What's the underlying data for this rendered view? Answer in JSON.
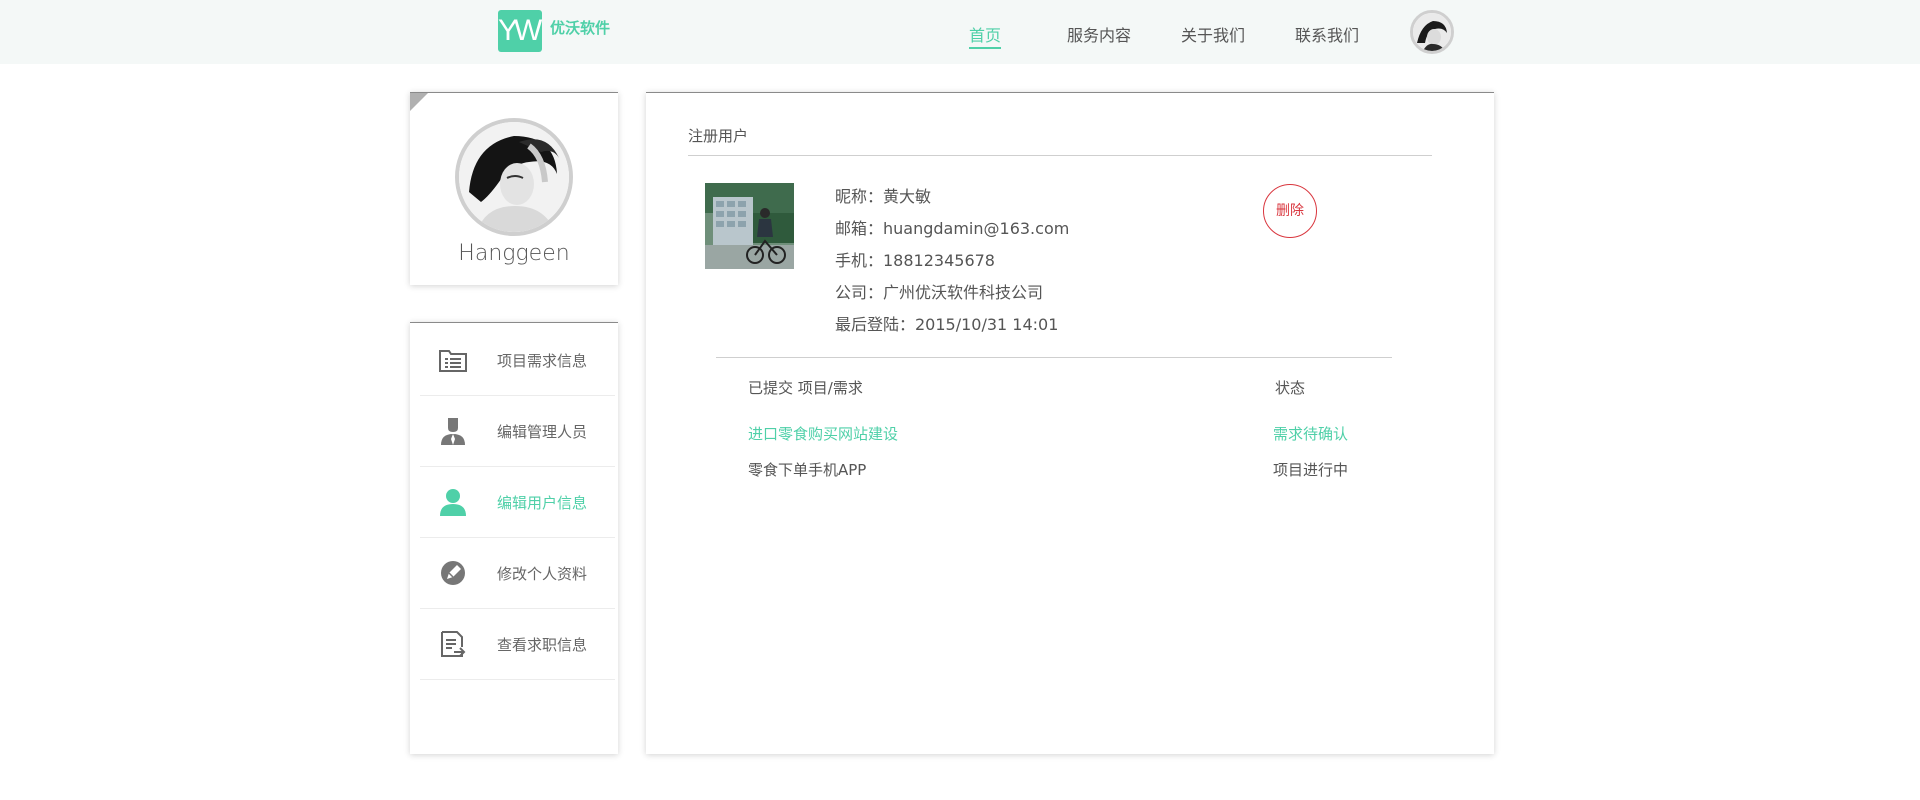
{
  "brand": {
    "logo_mark": "YW",
    "name": "优沃软件",
    "accent": "#4fd0a8"
  },
  "nav": {
    "items": [
      "首页",
      "服务内容",
      "关于我们",
      "联系我们"
    ],
    "active": "首页"
  },
  "profile": {
    "name": "Hanggeen"
  },
  "sidebar": {
    "items": [
      {
        "label": "项目需求信息",
        "icon": "list-folder-icon"
      },
      {
        "label": "编辑管理人员",
        "icon": "admin-user-icon"
      },
      {
        "label": "编辑用户信息",
        "icon": "user-icon",
        "active": true
      },
      {
        "label": "修改个人资料",
        "icon": "edit-pen-icon"
      },
      {
        "label": "查看求职信息",
        "icon": "document-arrow-icon"
      }
    ]
  },
  "main": {
    "section_title": "注册用户",
    "user": {
      "nickname": "昵称：黄大敏",
      "email": "邮箱：huangdamin@163.com",
      "phone": "手机：18812345678",
      "company": "公司：广州优沃软件科技公司",
      "last_login": "最后登陆：2015/10/31  14:01"
    },
    "delete_label": "删除",
    "delete_color": "#d9363e",
    "table": {
      "header_left": "已提交  项目/需求",
      "header_right": "状态",
      "rows": [
        {
          "name": "进口零食购买网站建设",
          "status": "需求待确认",
          "highlight": true
        },
        {
          "name": "零食下单手机APP",
          "status": "项目进行中",
          "highlight": false
        }
      ]
    }
  }
}
